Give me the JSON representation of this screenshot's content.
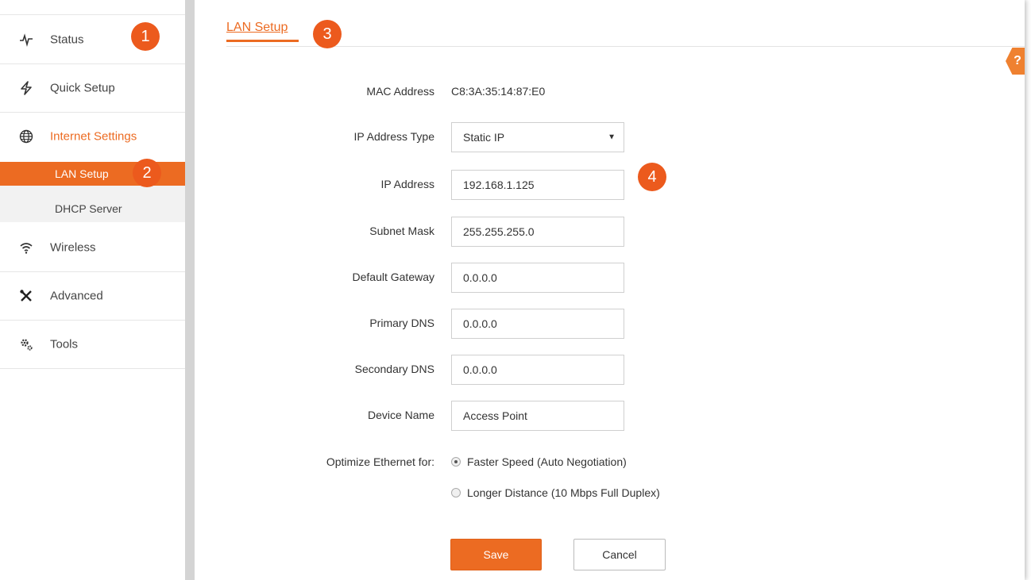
{
  "sidebar": {
    "items": [
      {
        "label": "Status",
        "icon": "pulse-icon"
      },
      {
        "label": "Quick Setup",
        "icon": "lightning-icon"
      },
      {
        "label": "Internet Settings",
        "icon": "globe-icon"
      },
      {
        "label": "Wireless",
        "icon": "wifi-icon"
      },
      {
        "label": "Advanced",
        "icon": "tools-icon"
      },
      {
        "label": "Tools",
        "icon": "gears-icon"
      }
    ],
    "subitems": [
      {
        "label": "LAN Setup"
      },
      {
        "label": "DHCP Server"
      }
    ]
  },
  "badges": {
    "b1": "1",
    "b2": "2",
    "b3": "3",
    "b4": "4"
  },
  "main": {
    "tab_title": "LAN Setup",
    "help_label": "?",
    "fields": {
      "mac_label": "MAC Address",
      "mac_value": "C8:3A:35:14:87:E0",
      "ip_type_label": "IP Address Type",
      "ip_type_value": "Static IP",
      "ip_label": "IP Address",
      "ip_value": "192.168.1.125",
      "subnet_label": "Subnet Mask",
      "subnet_value": "255.255.255.0",
      "gateway_label": "Default Gateway",
      "gateway_value": "0.0.0.0",
      "pdns_label": "Primary DNS",
      "pdns_value": "0.0.0.0",
      "sdns_label": "Secondary DNS",
      "sdns_value": "0.0.0.0",
      "device_label": "Device Name",
      "device_value": "Access Point"
    },
    "ethernet": {
      "label": "Optimize Ethernet for:",
      "option1": "Faster Speed (Auto Negotiation)",
      "option2": "Longer Distance (10 Mbps Full Duplex)",
      "selected": "option1"
    },
    "buttons": {
      "save": "Save",
      "cancel": "Cancel"
    }
  },
  "colors": {
    "accent": "#ec6b22",
    "badge": "#ec5a1d"
  }
}
